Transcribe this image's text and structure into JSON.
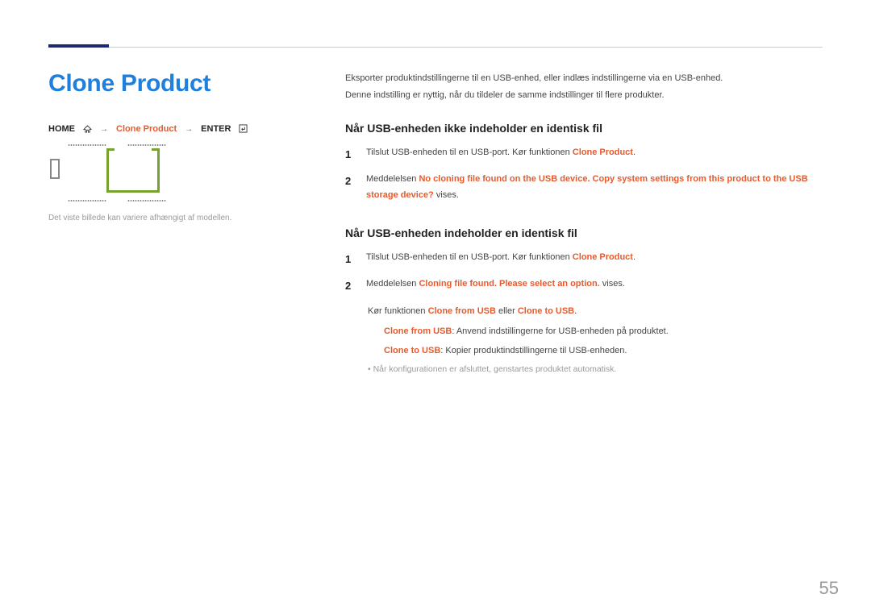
{
  "title": "Clone Product",
  "breadcrumb": {
    "home": "HOME",
    "item": "Clone Product",
    "enter": "ENTER"
  },
  "caption": "Det viste billede kan variere afhængigt af modellen.",
  "intro_line1": "Eksporter produktindstillingerne til en USB-enhed, eller indlæs indstillingerne via en USB-enhed.",
  "intro_line2": "Denne indstilling er nyttig, når du tildeler de samme indstillinger til flere produkter.",
  "sec1": {
    "head": "Når USB-enheden ikke indeholder en identisk fil",
    "step1_pre": "Tilslut USB-enheden til en USB-port. Kør funktionen ",
    "step1_accent": "Clone Product",
    "step1_post": ".",
    "step2_pre": "Meddelelsen ",
    "step2_accent": "No cloning file found on the USB device. Copy system settings from this product to the USB storage device?",
    "step2_post": " vises."
  },
  "sec2": {
    "head": "Når USB-enheden indeholder en identisk fil",
    "step1_pre": "Tilslut USB-enheden til en USB-port. Kør funktionen ",
    "step1_accent": "Clone Product",
    "step1_post": ".",
    "step2_pre": "Meddelelsen ",
    "step2_accent": "Cloning file found. Please select an option.",
    "step2_post": " vises.",
    "run_pre": "Kør funktionen ",
    "run_a": "Clone from USB",
    "run_mid": " eller ",
    "run_b": "Clone to USB",
    "run_post": ".",
    "cfu_label": "Clone from USB",
    "cfu_text": ": Anvend indstillingerne for USB-enheden på produktet.",
    "ctu_label": "Clone to USB",
    "ctu_text": ": Kopier produktindstillingerne til USB-enheden.",
    "note": "Når konfigurationen er afsluttet, genstartes produktet automatisk."
  },
  "page_number": "55",
  "nums": {
    "one": "1",
    "two": "2"
  }
}
